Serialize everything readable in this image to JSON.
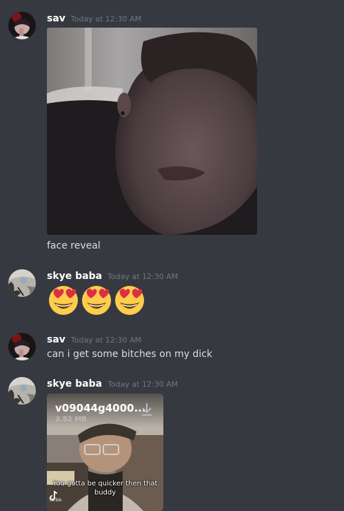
{
  "messages": [
    {
      "username": "sav",
      "timestamp": "Today at 12:30 AM",
      "attachment": "photo",
      "text": "face reveal"
    },
    {
      "username": "skye baba",
      "timestamp": "Today at 12:30 AM",
      "emojis": [
        "heart-eyes-emoji",
        "heart-eyes-emoji",
        "heart-eyes-emoji"
      ]
    },
    {
      "username": "sav",
      "timestamp": "Today at 12:30 AM",
      "text": "can i get some bitches on my dick"
    },
    {
      "username": "skye baba",
      "timestamp": "Today at 12:30 AM",
      "video": {
        "filename": "v09044g4000...",
        "size": "2.52 MB",
        "caption": "You gotta be quicker then that buddy",
        "watermark": "TikTok"
      }
    }
  ],
  "colors": {
    "background": "#36393f",
    "username": "#ffffff",
    "timestamp": "#72767d",
    "text": "#dcddde"
  }
}
